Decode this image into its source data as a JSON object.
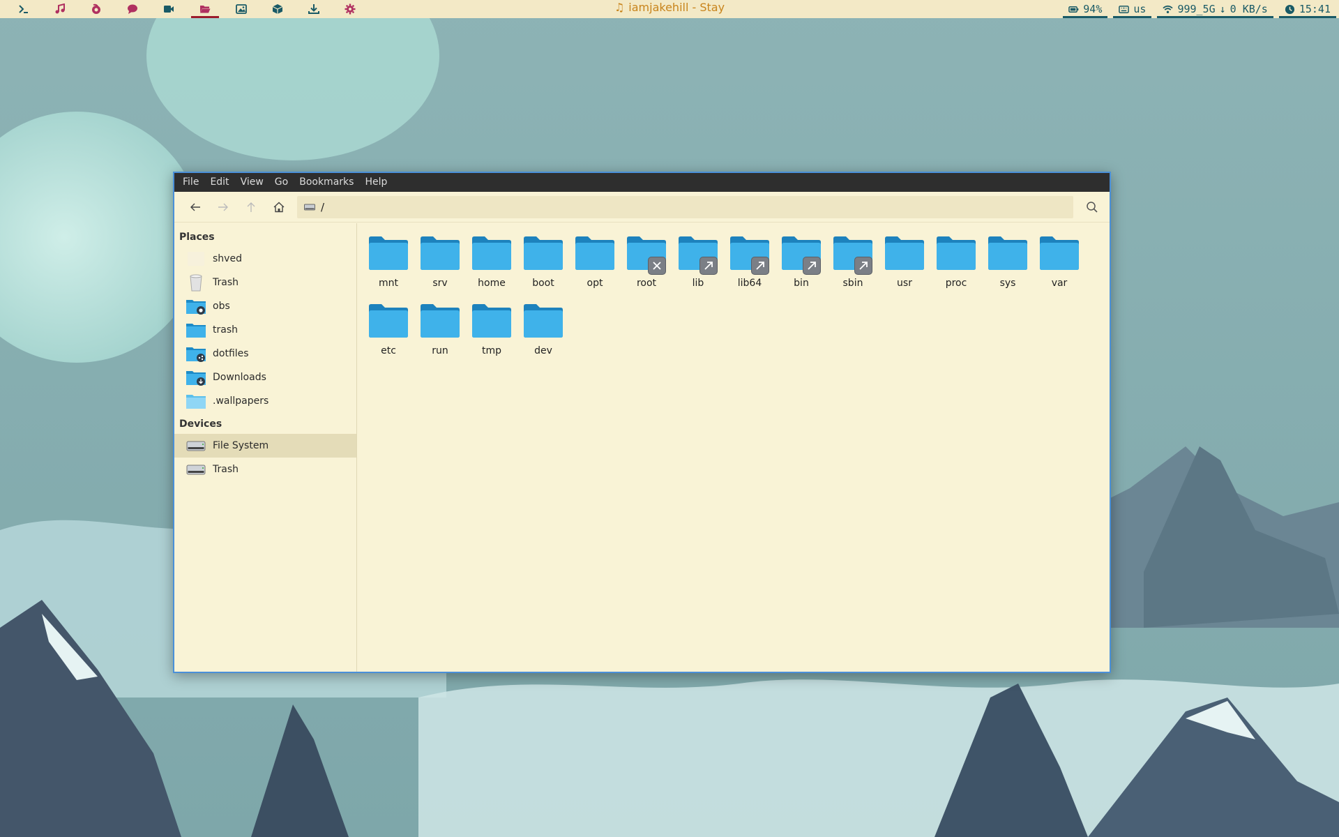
{
  "topbar": {
    "launchers": [
      {
        "icon": "terminal-icon",
        "color": "#195a66"
      },
      {
        "icon": "music-icon",
        "color": "#b03060"
      },
      {
        "icon": "browser-icon",
        "color": "#b03060"
      },
      {
        "icon": "chat-icon",
        "color": "#b03060"
      },
      {
        "icon": "video-icon",
        "color": "#195a66"
      },
      {
        "icon": "folder-icon",
        "color": "#b03060",
        "active": true
      },
      {
        "icon": "image-icon",
        "color": "#195a66"
      },
      {
        "icon": "package-icon",
        "color": "#195a66"
      },
      {
        "icon": "download-icon",
        "color": "#195a66"
      },
      {
        "icon": "settings-icon",
        "color": "#b03060"
      }
    ],
    "now_playing": "iamjakehill - Stay",
    "battery": "94%",
    "keyboard_layout": "us",
    "wifi": "999_5G",
    "network_speed": "0 KB/s",
    "clock": "15:41",
    "accent_color": "#195a66"
  },
  "window": {
    "menu": [
      "File",
      "Edit",
      "View",
      "Go",
      "Bookmarks",
      "Help"
    ],
    "location_path": "/",
    "sidebar": {
      "places_heading": "Places",
      "places": [
        {
          "label": "shved",
          "icon": "home-folder-icon"
        },
        {
          "label": "Trash",
          "icon": "trash-icon"
        },
        {
          "label": "obs",
          "icon": "camera-folder-icon"
        },
        {
          "label": "trash",
          "icon": "folder-icon"
        },
        {
          "label": "dotfiles",
          "icon": "shared-folder-icon"
        },
        {
          "label": "Downloads",
          "icon": "downloads-folder-icon"
        },
        {
          "label": ".wallpapers",
          "icon": "folder-icon"
        }
      ],
      "devices_heading": "Devices",
      "devices": [
        {
          "label": "File System",
          "icon": "drive-icon",
          "selected": true
        },
        {
          "label": "Trash",
          "icon": "drive-icon"
        }
      ]
    },
    "files": [
      {
        "name": "mnt",
        "emblem": ""
      },
      {
        "name": "srv",
        "emblem": ""
      },
      {
        "name": "home",
        "emblem": ""
      },
      {
        "name": "boot",
        "emblem": ""
      },
      {
        "name": "opt",
        "emblem": ""
      },
      {
        "name": "root",
        "emblem": "locked"
      },
      {
        "name": "lib",
        "emblem": "symlink"
      },
      {
        "name": "lib64",
        "emblem": "symlink"
      },
      {
        "name": "bin",
        "emblem": "symlink"
      },
      {
        "name": "sbin",
        "emblem": "symlink"
      },
      {
        "name": "usr",
        "emblem": ""
      },
      {
        "name": "proc",
        "emblem": ""
      },
      {
        "name": "sys",
        "emblem": ""
      },
      {
        "name": "var",
        "emblem": ""
      },
      {
        "name": "etc",
        "emblem": ""
      },
      {
        "name": "run",
        "emblem": ""
      },
      {
        "name": "tmp",
        "emblem": ""
      },
      {
        "name": "dev",
        "emblem": ""
      }
    ],
    "folder_color": "#3fb2ea",
    "selection_border": "#4a90d9"
  }
}
